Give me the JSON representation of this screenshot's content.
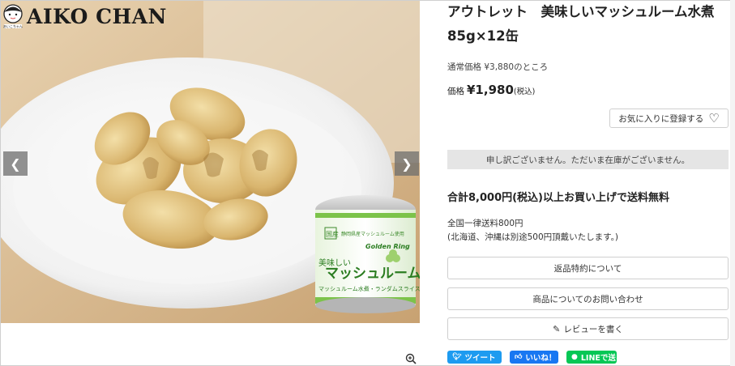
{
  "brand": {
    "name": "AIKO CHAN"
  },
  "gallery": {
    "prev_icon": "chevron-left-icon",
    "next_icon": "chevron-right-icon",
    "zoom_icon": "magnifier-plus-icon",
    "can_label_brand": "Golden Ring",
    "can_label_main": "マッシュルーム",
    "can_label_prefix": "美味しい",
    "can_label_origin": "静岡県産マッシュルーム使用",
    "can_label_top": "国産",
    "can_label_sub": "マッシュルーム水煮・ランダムスライス"
  },
  "product": {
    "title_line1": "アウトレット　美味しいマッシュルーム水煮",
    "title_line2": "85g×12缶",
    "regular_price_text": "通常価格 ¥3,880のところ",
    "price_label": "価格",
    "price_value": "¥1,980",
    "price_tax": "(税込)"
  },
  "favorite": {
    "label": "お気に入りに登録する",
    "icon": "heart-outline-icon"
  },
  "stock": {
    "message": "申し訳ございません。ただいま在庫がございません。"
  },
  "shipping": {
    "free_shipping": "合計8,000円(税込)以上お買い上げで送料無料",
    "note_line1": "全国一律送料800円",
    "note_line2": "(北海道、沖縄は別途500円頂戴いたします。)"
  },
  "actions": {
    "return_policy": "返品特約について",
    "inquiry": "商品についてのお問い合わせ",
    "review": "レビューを書く",
    "review_icon": "pencil-icon"
  },
  "social": {
    "tweet": "ツイート",
    "like": "いいね！",
    "line": "LINEで送る"
  },
  "colors": {
    "twitter": "#1d9bf0",
    "facebook": "#1877f2",
    "line": "#06c755",
    "soldout_bg": "#e5e5e5",
    "can_green": "#7cc34a"
  }
}
